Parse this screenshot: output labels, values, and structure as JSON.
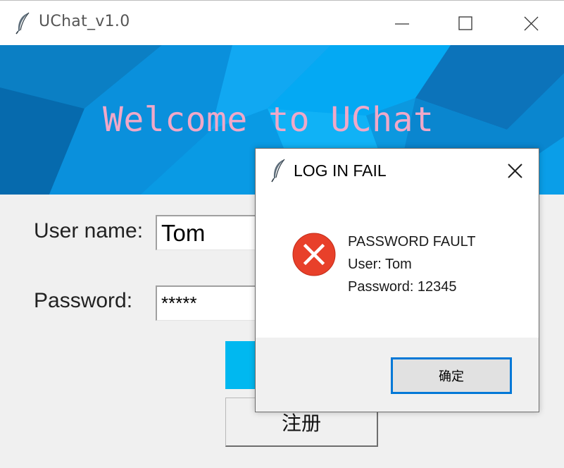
{
  "window": {
    "title": "UChat_v1.0",
    "icons": {
      "app": "feather-icon",
      "minimize": "minimize-icon",
      "maximize": "maximize-icon",
      "close": "close-icon"
    }
  },
  "banner": {
    "title": "Welcome to UChat",
    "title_color": "#f0a8c8",
    "bg_color": "#0a9ee8"
  },
  "form": {
    "username_label": "User name:",
    "username_value": "Tom",
    "password_label": "Password:",
    "password_value": "*****",
    "login_label": "",
    "register_label": "注册"
  },
  "dialog": {
    "title": "LOG IN FAIL",
    "icon": "error-icon",
    "message_lines": [
      "PASSWORD FAULT",
      "User: Tom",
      "Password: 12345"
    ],
    "ok_label": "确定",
    "accent_color": "#0078d7",
    "error_color": "#e8402a"
  }
}
